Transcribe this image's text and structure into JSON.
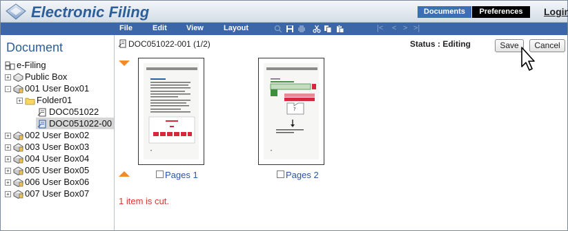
{
  "app": {
    "title": "Electronic Filing"
  },
  "header": {
    "tabs": [
      {
        "label": "Documents"
      },
      {
        "label": "Preferences"
      }
    ],
    "login_label": "Login"
  },
  "menubar": {
    "items": [
      "File",
      "Edit",
      "View",
      "Layout"
    ],
    "toolbar_icons": [
      "search-icon",
      "save-icon",
      "print-icon",
      "cut-icon",
      "copy-icon",
      "paste-icon"
    ],
    "nav_arrows": [
      "|<",
      "<",
      ">",
      ">|"
    ]
  },
  "sidebar": {
    "title": "Document",
    "tree": [
      {
        "label": "e-Filing",
        "expander": "",
        "icon": "efiling-root-icon"
      },
      {
        "label": "Public Box",
        "expander": "+",
        "icon": "public-box-icon"
      },
      {
        "label": "001 User Box01",
        "expander": "-",
        "icon": "user-box-icon"
      },
      {
        "label": "Folder01",
        "expander": "+",
        "icon": "folder-icon"
      },
      {
        "label": "DOC051022",
        "expander": "",
        "icon": "document-icon"
      },
      {
        "label": "DOC051022-00",
        "expander": "",
        "icon": "document-icon",
        "selected": true
      },
      {
        "label": "002 User Box02",
        "expander": "+",
        "icon": "user-box-icon"
      },
      {
        "label": "003 User Box03",
        "expander": "+",
        "icon": "user-box-icon"
      },
      {
        "label": "004 User Box04",
        "expander": "+",
        "icon": "user-box-icon"
      },
      {
        "label": "005 User Box05",
        "expander": "+",
        "icon": "user-box-icon"
      },
      {
        "label": "006 User Box06",
        "expander": "+",
        "icon": "user-box-icon"
      },
      {
        "label": "007 User Box07",
        "expander": "+",
        "icon": "user-box-icon"
      }
    ]
  },
  "main": {
    "doc_title": "DOC051022-001  (1/2)",
    "status": "Status : Editing",
    "save_label": "Save",
    "cancel_label": "Cancel",
    "pages": [
      {
        "label": "Pages 1",
        "checked": false
      },
      {
        "label": "Pages 2",
        "checked": false
      }
    ],
    "page2_question": "?",
    "message": "1 item is cut."
  },
  "colors": {
    "brand": "#2c5e99",
    "menubar": "#3b67a8",
    "accent_arrow": "#f28c28",
    "message": "#e0342c",
    "link": "#2a55a0"
  }
}
